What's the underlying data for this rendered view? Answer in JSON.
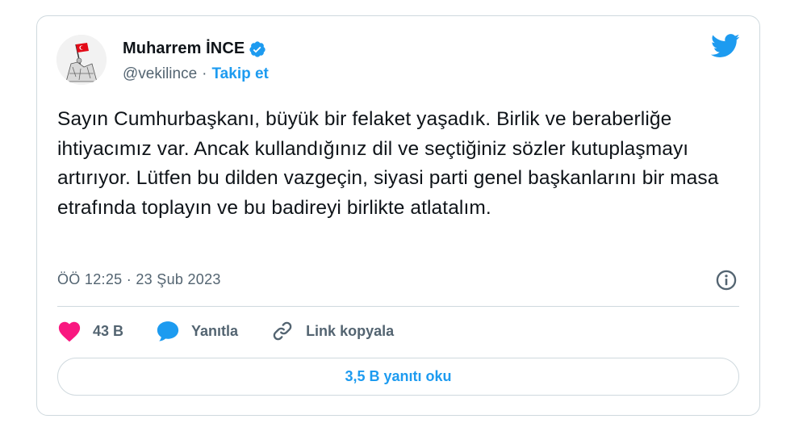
{
  "author": {
    "display_name": "Muharrem İNCE",
    "handle": "@vekilince",
    "separator": "·",
    "follow_label": "Takip et"
  },
  "tweet": {
    "text": "Sayın Cumhurbaşkanı, büyük bir felaket yaşadık. Birlik ve beraberliğe ihtiyacımız var. Ancak kullandığınız dil ve seçtiğiniz sözler kutuplaşmayı artırıyor. Lütfen bu dilden vazgeçin, siyasi parti genel başkanlarını bir masa etrafında toplayın ve bu badireyi birlikte atlatalım.",
    "timestamp": "ÖÖ 12:25 · 23 Şub 2023"
  },
  "actions": {
    "likes": "43 B",
    "reply_label": "Yanıtla",
    "copy_link_label": "Link kopyala",
    "read_replies_label": "3,5 B yanıtı oku"
  },
  "icons": {
    "brand": "twitter-bird-icon",
    "verified": "verified-badge-icon",
    "info": "info-icon",
    "like": "heart-icon",
    "reply": "speech-bubble-icon",
    "link": "link-icon"
  },
  "colors": {
    "accent": "#1d9bf0",
    "like": "#f91880",
    "text": "#0f1419",
    "muted": "#536471",
    "border": "#cfd9de"
  }
}
